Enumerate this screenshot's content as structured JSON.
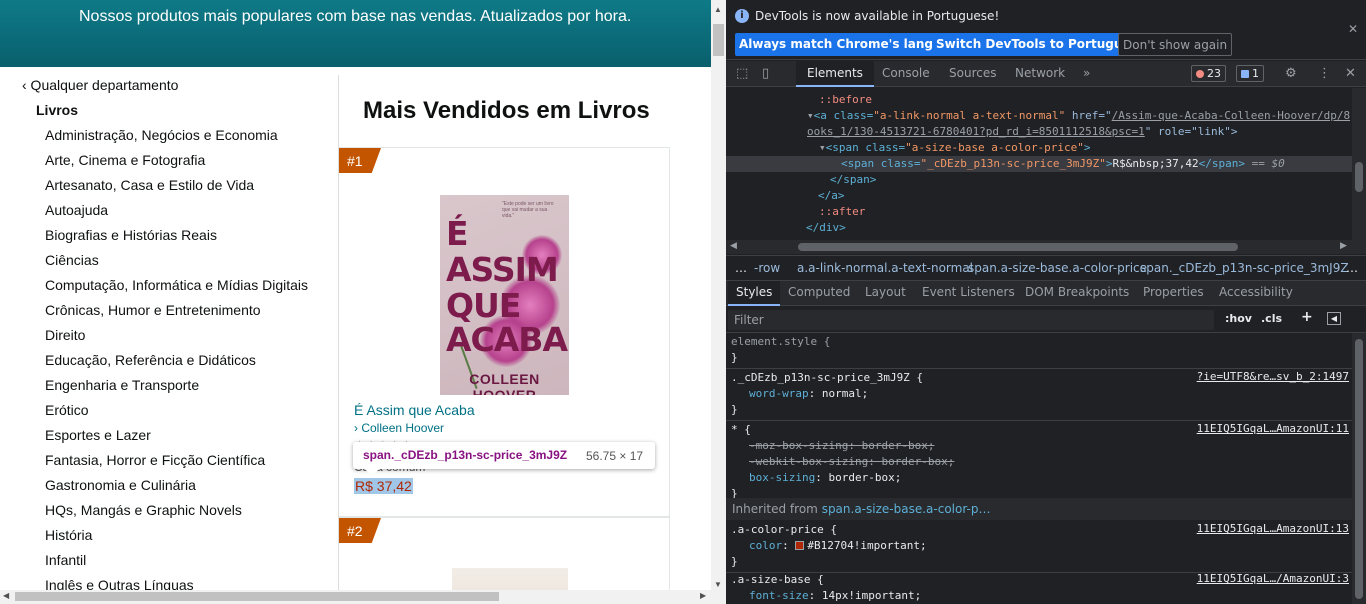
{
  "page": {
    "banner_text": "Nossos produtos mais populares com base nas vendas. Atualizados por hora.",
    "departments": {
      "back_label": "‹ Qualquer departamento",
      "current": "Livros",
      "items": [
        "Administração, Negócios e Economia",
        "Arte, Cinema e Fotografia",
        "Artesanato, Casa e Estilo de Vida",
        "Autoajuda",
        "Biografias e Histórias Reais",
        "Ciências",
        "Computação, Informática e Mídias Digitais",
        "Crônicas, Humor e Entretenimento",
        "Direito",
        "Educação, Referência e Didáticos",
        "Engenharia e Transporte",
        "Erótico",
        "Esportes e Lazer",
        "Fantasia, Horror e Ficção Científica",
        "Gastronomia e Culinária",
        "HQs, Mangás e Graphic Novels",
        "História",
        "Infantil",
        "Inglês e Outras Línguas"
      ]
    },
    "title": "Mais Vendidos em Livros",
    "products": [
      {
        "rank": "#1",
        "cover_lines": [
          "É",
          "ASSIM",
          "QUE",
          "ACABA"
        ],
        "cover_author": "COLLEEN HOOVER",
        "cover_tagline": "\"Este pode ser um livro que vai mudar a sua vida.\"",
        "title": "É Assim que Acaba",
        "author": "Colleen Hoover",
        "rating": "★★★★★",
        "format": "Capa comum",
        "price": "R$ 37,42"
      },
      {
        "rank": "#2"
      }
    ]
  },
  "inspect_tooltip": {
    "selector": "span._cDEzb_p13n-sc-price_3mJ9Z",
    "dimensions": "56.75 × 17"
  },
  "devtools": {
    "infobar": {
      "message": "DevTools is now available in Portuguese!",
      "btn_match": "Always match Chrome's language",
      "btn_switch": "Switch DevTools to Portuguese",
      "btn_dismiss": "Don't show again"
    },
    "tabs": [
      "Elements",
      "Console",
      "Sources",
      "Network",
      "»"
    ],
    "error_count": "23",
    "message_count": "1",
    "code": {
      "line0": "::before",
      "line1_pre": "<a class=",
      "line1_val": "\"a-link-normal a-text-normal\"",
      "line1_href": " href=\"",
      "line1_link": "/Assim-que-Acaba-Colleen-Hoover/dp/8",
      "line2_link": "ooks_1/130-4513721-6780401?pd_rd_i=8501112518&psc=1",
      "line2_rest": "\" role=\"link\">",
      "line3_tag": "<span class=",
      "line3_val": "\"a-size-base a-color-price\"",
      "line4_tag": "<span class=",
      "line4_val": "\"_cDEzb_p13n-sc-price_3mJ9Z\"",
      "line4_text": "R$&nbsp;37,42",
      "line4_close": "</span>",
      "line4_eq": "== $0",
      "line5": "</span>",
      "line6": "</a>",
      "line7": "::after",
      "line8": "</div>"
    },
    "breadcrumbs": [
      "…",
      "-row",
      "a.a-link-normal.a-text-normal",
      "span.a-size-base.a-color-price",
      "span._cDEzb_p13n-sc-price_3mJ9Z",
      "…"
    ],
    "subtabs": [
      "Styles",
      "Computed",
      "Layout",
      "Event Listeners",
      "DOM Breakpoints",
      "Properties",
      "Accessibility"
    ],
    "filter_placeholder": "Filter",
    "hov": ":hov",
    "cls": ".cls",
    "styles": {
      "element_style": "element.style {",
      "rule1_selector": "._cDEzb_p13n-sc-price_3mJ9Z {",
      "rule1_source": "?ie=UTF8&re…sv_b_2:1497",
      "rule1_prop": "word-wrap",
      "rule1_val": "normal;",
      "rule2_selector": "* {",
      "rule2_source": "11EIQ5IGqaL…AmazonUI:11",
      "rule2_p1": "-moz-box-sizing",
      "rule2_v1": "border-box;",
      "rule2_p2": "-webkit-box-sizing",
      "rule2_v2": "border-box;",
      "rule2_p3": "box-sizing",
      "rule2_v3": "border-box;",
      "inherited_label": "Inherited from",
      "inherited_from": "span.a-size-base.a-color-p…",
      "rule3_selector": ".a-color-price {",
      "rule3_source": "11EIQ5IGqaL…AmazonUI:13",
      "rule3_prop": "color",
      "rule3_val": "#B12704!important;",
      "rule4_selector": ".a-size-base {",
      "rule4_source": "11EIQ5IGqaL…/AmazonUI:3",
      "rule4_prop": "font-size",
      "rule4_val": "14px!important;",
      "close_brace": "}"
    }
  },
  "colors": {
    "price": "#B12704",
    "teal_banner": "#0b6a78",
    "link": "#007185",
    "devtools_bg": "#202124",
    "accent": "#8ab4f8"
  }
}
